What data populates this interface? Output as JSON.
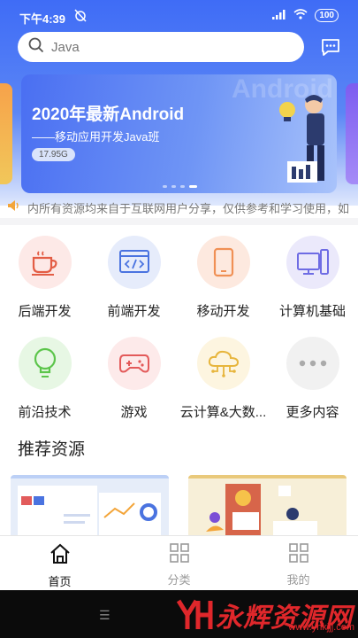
{
  "status": {
    "time": "下午4:39",
    "battery": "100"
  },
  "search": {
    "placeholder": "Java"
  },
  "banner": {
    "title": "2020年最新Android",
    "subtitle": "——移动应用开发Java班",
    "tag": "17.95G",
    "watermark": "Android"
  },
  "notice": {
    "text": "内所有资源均来自于互联网用户分享，仅供参考和学习使用，如"
  },
  "categories": [
    {
      "label": "后端开发",
      "icon": "coffee-cup-icon",
      "bg": "#fde9e7",
      "color": "#e35d45"
    },
    {
      "label": "前端开发",
      "icon": "code-window-icon",
      "bg": "#e6ecfb",
      "color": "#4a73e0"
    },
    {
      "label": "移动开发",
      "icon": "phone-icon",
      "bg": "#fde9df",
      "color": "#f09055"
    },
    {
      "label": "计算机基础",
      "icon": "computer-icon",
      "bg": "#ebe9fb",
      "color": "#6e6ce4"
    },
    {
      "label": "前沿技术",
      "icon": "lightbulb-icon",
      "bg": "#e7f7e4",
      "color": "#5cc54b"
    },
    {
      "label": "游戏",
      "icon": "gamepad-icon",
      "bg": "#fdeaea",
      "color": "#e35a5a"
    },
    {
      "label": "云计算&大数...",
      "icon": "cloud-icon",
      "bg": "#fdf5e0",
      "color": "#e7b53c"
    },
    {
      "label": "更多内容",
      "icon": "more-dots-icon",
      "bg": "#f1f1f1",
      "color": "#aaaaaa"
    }
  ],
  "section": {
    "title": "推荐资源"
  },
  "nav": [
    {
      "label": "首页",
      "icon": "home-icon",
      "active": true
    },
    {
      "label": "分类",
      "icon": "grid-icon",
      "active": false
    },
    {
      "label": "我的",
      "icon": "grid-icon",
      "active": false
    }
  ],
  "watermark": {
    "name": "永辉资源网",
    "url": "www.yhkjjj.com"
  }
}
